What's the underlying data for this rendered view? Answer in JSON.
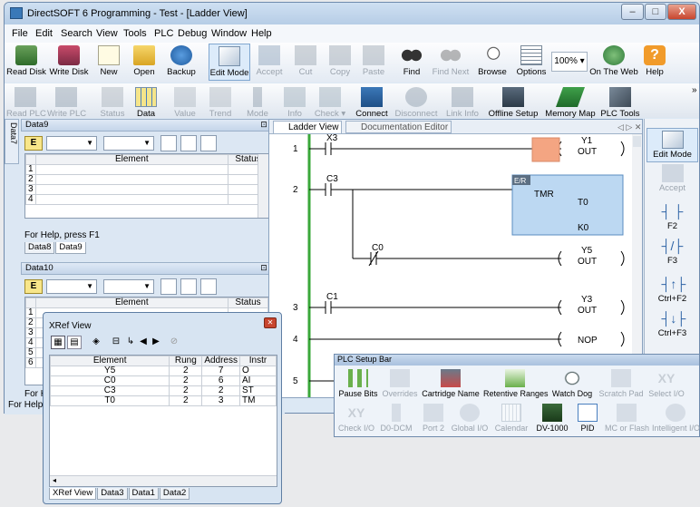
{
  "window": {
    "title": "DirectSOFT 6 Programming - Test - [Ladder View]",
    "min": "–",
    "max": "□",
    "close": "X"
  },
  "menu": [
    "File",
    "Edit",
    "Search",
    "View",
    "Tools",
    "PLC",
    "Debug",
    "Window",
    "Help"
  ],
  "toolbar1": {
    "read_disk": "Read Disk",
    "write_disk": "Write Disk",
    "new": "New",
    "open": "Open",
    "backup": "Backup",
    "edit_mode": "Edit Mode",
    "accept": "Accept",
    "cut": "Cut",
    "copy": "Copy",
    "paste": "Paste",
    "find": "Find",
    "find_next": "Find Next",
    "browse": "Browse",
    "options": "Options",
    "zoom": "100%",
    "on_the_web": "On The Web",
    "help": "Help"
  },
  "toolbar2": {
    "read_plc": "Read PLC",
    "write_plc": "Write PLC",
    "status": "Status",
    "data": "Data",
    "value": "Value",
    "trend": "Trend",
    "mode": "Mode",
    "info": "Info",
    "check": "Check",
    "connect": "Connect",
    "disconnect": "Disconnect",
    "link_info": "Link Info",
    "offline_setup": "Offline Setup",
    "memory_map": "Memory Map",
    "plc_tools": "PLC Tools"
  },
  "side_tab": "Data7",
  "data9": {
    "title": "Data9",
    "e_label": "E",
    "col_element": "Element",
    "col_status": "Status",
    "rows": [
      "1",
      "2",
      "3",
      "4"
    ],
    "help": "For Help, press F1",
    "tabs": [
      "Data8",
      "Data9"
    ]
  },
  "data10": {
    "title": "Data10",
    "e_label": "E",
    "col_element": "Element",
    "col_status": "Status",
    "rows": [
      "1",
      "2",
      "3",
      "4",
      "5",
      "6"
    ],
    "help_short": "For H",
    "help_short2": "For Help"
  },
  "ladder": {
    "tabs": [
      "Ladder View",
      "Documentation Editor"
    ],
    "rungs": [
      "1",
      "2",
      "3",
      "4",
      "5"
    ],
    "contacts": {
      "x3": "X3",
      "c3": "C3",
      "c0": "C0",
      "c1": "C1"
    },
    "coils": {
      "y1": "Y1",
      "y5": "Y5",
      "y3": "Y3",
      "out": "OUT",
      "nop": "NOP"
    },
    "tmr": {
      "tag": "E/R",
      "type": "TMR",
      "t": "T0",
      "k": "K0"
    }
  },
  "rightbar": {
    "edit_mode": "Edit Mode",
    "accept": "Accept",
    "f2": "F2",
    "f3": "F3",
    "ctrl_f2": "Ctrl+F2",
    "ctrl_f3": "Ctrl+F3"
  },
  "xref": {
    "title": "XRef View",
    "cols": [
      "Element",
      "Rung",
      "Address",
      "Instr"
    ],
    "rows": [
      {
        "el": "Y5",
        "rung": "2",
        "addr": "7",
        "instr": "O"
      },
      {
        "el": "C0",
        "rung": "2",
        "addr": "6",
        "instr": "AI"
      },
      {
        "el": "C3",
        "rung": "2",
        "addr": "2",
        "instr": "ST"
      },
      {
        "el": "T0",
        "rung": "2",
        "addr": "3",
        "instr": "TM"
      }
    ],
    "tabs": [
      "XRef View",
      "Data3",
      "Data1",
      "Data2"
    ]
  },
  "plcbar": {
    "title": "PLC Setup Bar",
    "row1": [
      "Pause Bits",
      "Overrides",
      "Cartridge Name",
      "Retentive Ranges",
      "Watch Dog",
      "Scratch Pad",
      "Select I/O"
    ],
    "row2": [
      "Check I/O",
      "D0-DCM",
      "Port 2",
      "Global I/O",
      "Calendar",
      "DV-1000",
      "PID",
      "MC or Flash",
      "Intelligent I/O"
    ]
  }
}
